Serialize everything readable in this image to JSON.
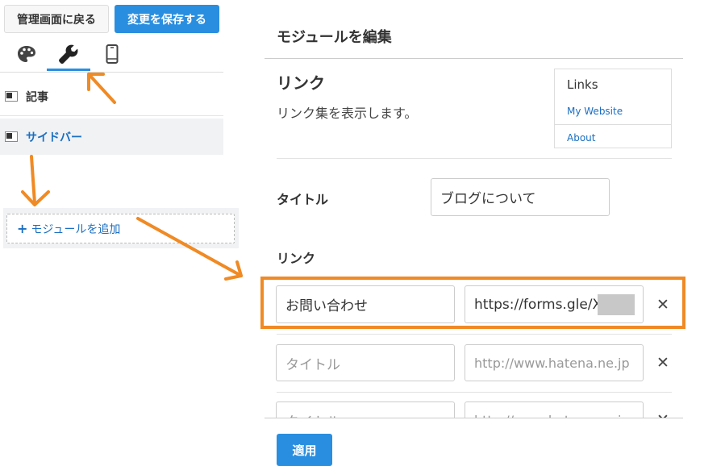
{
  "toolbar": {
    "back_label": "管理画面に戻る",
    "save_label": "変更を保存する"
  },
  "tabs": [
    {
      "icon": "palette-icon"
    },
    {
      "icon": "wrench-icon",
      "active": true
    },
    {
      "icon": "mobile-icon"
    }
  ],
  "sidebar": {
    "rows": [
      {
        "label": "記事"
      },
      {
        "label": "サイドバー",
        "selected": true
      }
    ],
    "add_module_label": "モジュールを追加",
    "add_module_plus": "+"
  },
  "panel": {
    "title": "モジュールを編集",
    "module_name": "リンク",
    "module_desc": "リンク集を表示します。",
    "preview": {
      "heading": "Links",
      "link1": "My Website",
      "link2": "About"
    },
    "title_label": "タイトル",
    "title_value": "ブログについて",
    "links_label": "リンク",
    "link_rows": [
      {
        "title_value": "お問い合わせ",
        "url_value": "https://forms.gle/X"
      },
      {
        "title_placeholder": "タイトル",
        "url_placeholder": "http://www.hatena.ne.jp"
      },
      {
        "title_placeholder": "タイトル",
        "url_placeholder": "http://www.hatena.ne.jp"
      }
    ],
    "remove_glyph": "✕",
    "apply_label": "適用"
  },
  "colors": {
    "accent": "#2a8ee0",
    "annotation": "#f08a24",
    "link": "#1a6fc2"
  }
}
